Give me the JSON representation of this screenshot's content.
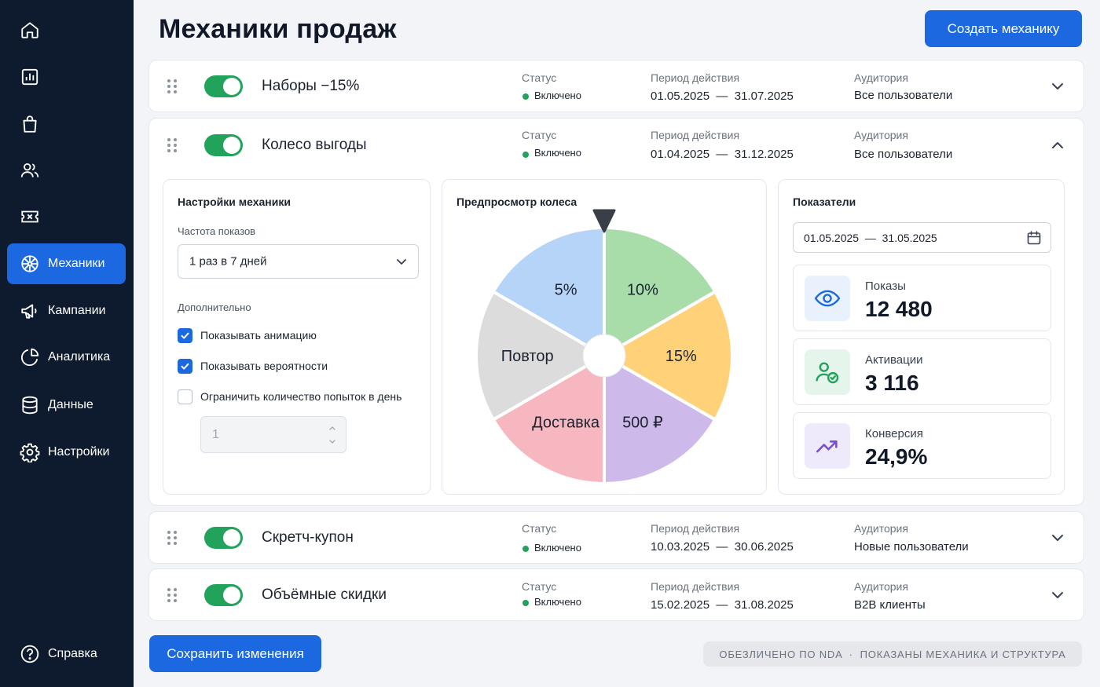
{
  "sidebar": {
    "items": [
      {
        "label": "",
        "icon": "home-icon"
      },
      {
        "label": "",
        "icon": "chart-icon"
      },
      {
        "label": "",
        "icon": "shopping-bag-icon"
      },
      {
        "label": "",
        "icon": "users-icon"
      },
      {
        "label": "",
        "icon": "ticket-icon"
      },
      {
        "label": "Механики",
        "icon": "wheel-icon",
        "active": true
      },
      {
        "label": "Кампании",
        "icon": "megaphone-icon"
      },
      {
        "label": "Аналитика",
        "icon": "pie-chart-icon"
      },
      {
        "label": "Данные",
        "icon": "database-icon"
      },
      {
        "label": "Настройки",
        "icon": "gear-icon"
      }
    ],
    "help_label": "Справка"
  },
  "header": {
    "title": "Механики продаж",
    "create_button": "Создать механику"
  },
  "labels": {
    "status": "Статус",
    "period": "Период действия",
    "audience": "Аудитория"
  },
  "mechanics": [
    {
      "name": "Наборы −15%",
      "status": "Включено",
      "period": "01.05.2025  —  31.07.2025",
      "audience": "Все пользователи",
      "enabled": true,
      "expanded": false
    },
    {
      "name": "Колесо выгоды",
      "status": "Включено",
      "period": "01.04.2025  —  31.12.2025",
      "audience": "Все пользователи",
      "enabled": true,
      "expanded": true
    },
    {
      "name": "Скретч-купон",
      "status": "Включено",
      "period": "10.03.2025  —  30.06.2025",
      "audience": "Новые пользователи",
      "enabled": true,
      "expanded": false
    },
    {
      "name": "Объёмные скидки",
      "status": "Включено",
      "period": "15.02.2025  —  31.08.2025",
      "audience": "B2B клиенты",
      "enabled": true,
      "expanded": false
    }
  ],
  "settings": {
    "title": "Настройки механики",
    "frequency_label": "Частота показов",
    "frequency_value": "1 раз в 7 дней",
    "extra_label": "Дополнительно",
    "options": [
      {
        "label": "Показывать анимацию",
        "checked": true
      },
      {
        "label": "Показывать вероятности",
        "checked": true
      },
      {
        "label": "Ограничить количество попыток в день",
        "checked": false
      }
    ],
    "attempts_value": "1"
  },
  "wheel": {
    "title": "Предпросмотр колеса",
    "segments": [
      {
        "label": "10%",
        "color": "#a8dca8"
      },
      {
        "label": "15%",
        "color": "#ffd27a"
      },
      {
        "label": "500 ₽",
        "color": "#cdb9ea"
      },
      {
        "label": "Доставка",
        "color": "#f6b7c1"
      },
      {
        "label": "Повтор",
        "color": "#dcdcdc"
      },
      {
        "label": "5%",
        "color": "#b6d4f8"
      }
    ]
  },
  "metrics": {
    "title": "Показатели",
    "date_range": "01.05.2025  —  31.05.2025",
    "cards": [
      {
        "label": "Показы",
        "value": "12 480",
        "icon": "eye-icon",
        "bg": "#e8f1fc",
        "fg": "#1b68e0"
      },
      {
        "label": "Активации",
        "value": "3 116",
        "icon": "user-check-icon",
        "bg": "#e6f5ec",
        "fg": "#22a35b"
      },
      {
        "label": "Конверсия",
        "value": "24,9%",
        "icon": "trend-up-icon",
        "bg": "#efeafb",
        "fg": "#7c4dcc"
      }
    ]
  },
  "footer": {
    "save_button": "Сохранить изменения",
    "nda_note": "ОБЕЗЛИЧЕНО ПО NDA  ·  ПОКАЗАНЫ МЕХАНИКА И СТРУКТУРА"
  }
}
